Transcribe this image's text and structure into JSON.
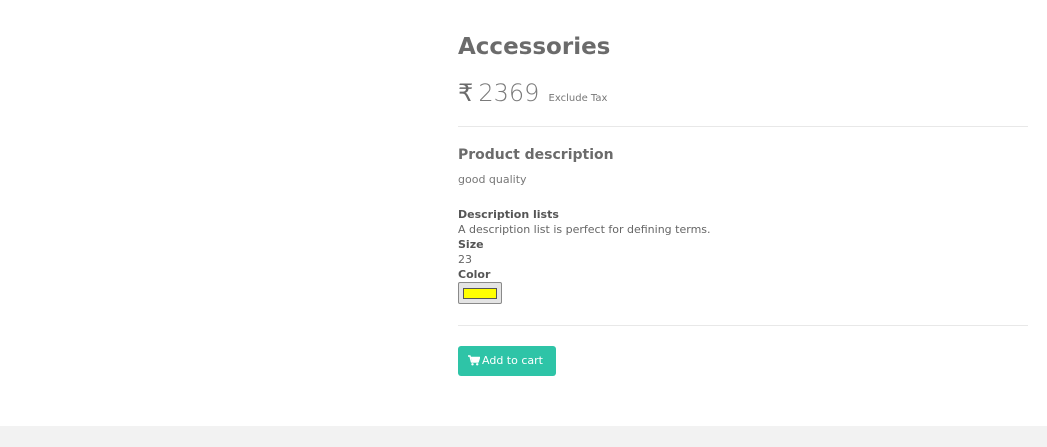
{
  "product": {
    "title": "Accessories",
    "currency_symbol": "₹",
    "price": "2369",
    "tax_note": "Exclude Tax"
  },
  "description": {
    "heading": "Product description",
    "text": "good quality"
  },
  "details": {
    "list_title": "Description lists",
    "list_text": "A description list is perfect for defining terms.",
    "size_label": "Size",
    "size_value": "23",
    "color_label": "Color",
    "color_value": "#ffff00"
  },
  "actions": {
    "add_to_cart_label": "Add to cart",
    "add_to_cart_icon": "shopping-cart-icon"
  },
  "colors": {
    "button_bg": "#2ec4a7",
    "footer_bg": "#f2f2f2"
  }
}
